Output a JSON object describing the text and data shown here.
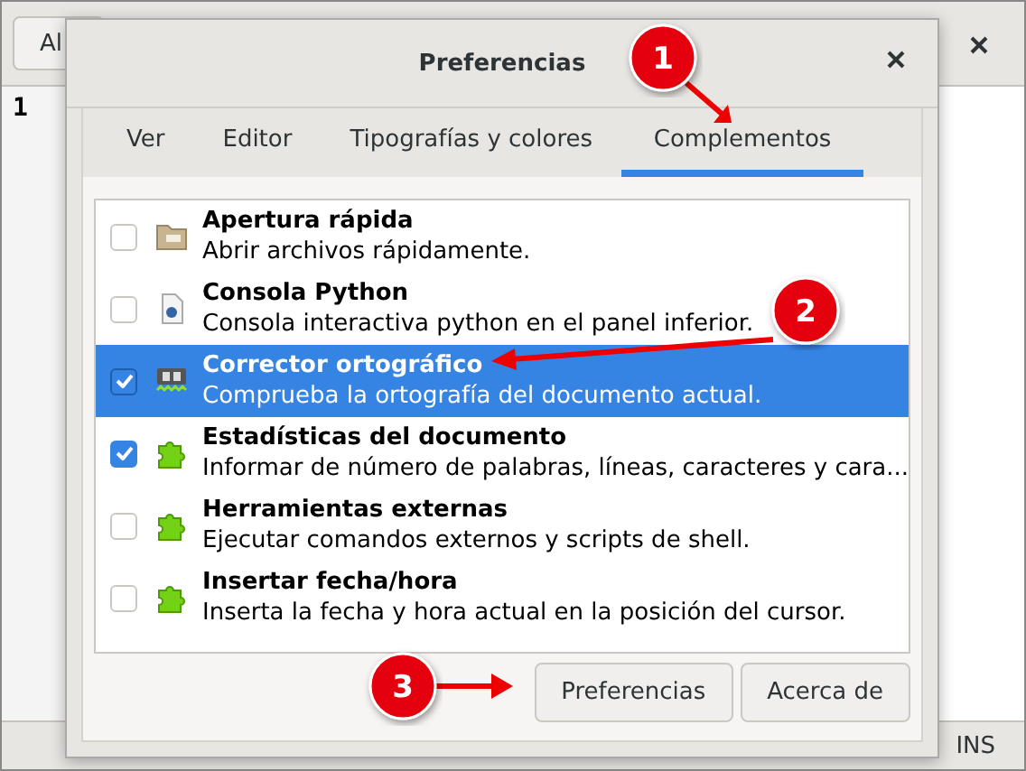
{
  "app": {
    "header_button": "Al",
    "line_number": "1",
    "status_bar": {
      "mode": "INS"
    }
  },
  "dialog": {
    "title": "Preferencias",
    "tabs": [
      {
        "label": "Ver",
        "selected": false
      },
      {
        "label": "Editor",
        "selected": false
      },
      {
        "label": "Tipografías y colores",
        "selected": false
      },
      {
        "label": "Complementos",
        "selected": true
      }
    ],
    "plugins": [
      {
        "name": "Apertura rápida",
        "description": "Abrir archivos rápidamente.",
        "kind": "folder",
        "checked": false,
        "selected": false
      },
      {
        "name": "Consola Python",
        "description": "Consola interactiva python en el panel inferior.",
        "kind": "script",
        "checked": false,
        "selected": false
      },
      {
        "name": "Corrector ortográfico",
        "description": "Comprueba la ortografía del documento actual.",
        "kind": "spell",
        "checked": true,
        "selected": true
      },
      {
        "name": "Estadísticas del documento",
        "description": "Informar de número de palabras, líneas, caracteres y cara...",
        "kind": "puzzle",
        "checked": true,
        "selected": false
      },
      {
        "name": "Herramientas externas",
        "description": "Ejecutar comandos externos y scripts de shell.",
        "kind": "puzzle",
        "checked": false,
        "selected": false
      },
      {
        "name": "Insertar fecha/hora",
        "description": "Inserta la fecha y hora actual en la posición del cursor.",
        "kind": "puzzle",
        "checked": false,
        "selected": false
      }
    ],
    "buttons": [
      "Preferencias",
      "Acerca de"
    ]
  },
  "annotations": [
    {
      "label": "1"
    },
    {
      "label": "2"
    },
    {
      "label": "3"
    }
  ]
}
